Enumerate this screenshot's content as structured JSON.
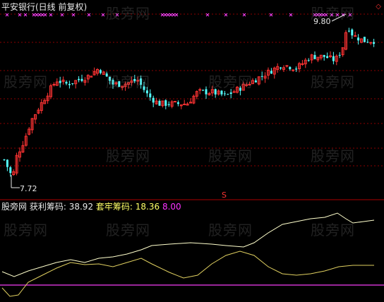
{
  "window": {
    "title": "平安银行(日线 前复权)"
  },
  "main_chart": {
    "high_label": "9.80",
    "low_label": "7.72",
    "marker": "S",
    "colors": {
      "up": "#ff3333",
      "down": "#54ffff",
      "grid": "#8b0000",
      "marks": "#ff44ff"
    }
  },
  "indicator_panel": {
    "name": "股旁网",
    "label1": "获利筹码:",
    "value1": "38.92",
    "label2": "套牢筹码:",
    "value2": "18.36",
    "value3": "8.00",
    "colors": {
      "profit_line": "#ffffcc",
      "trapped_line": "#e0d060",
      "ref_line": "#cc33cc"
    }
  },
  "watermark": "股旁网",
  "chart_data": {
    "type": "candlestick",
    "price_range": [
      7.5,
      9.9
    ],
    "title": "平安银行(日线 前复权)",
    "series": [
      {
        "name": "获利筹码",
        "last": 38.92
      },
      {
        "name": "套牢筹码",
        "last": 18.36
      },
      {
        "name": "8.00",
        "last": 8.0
      }
    ]
  }
}
